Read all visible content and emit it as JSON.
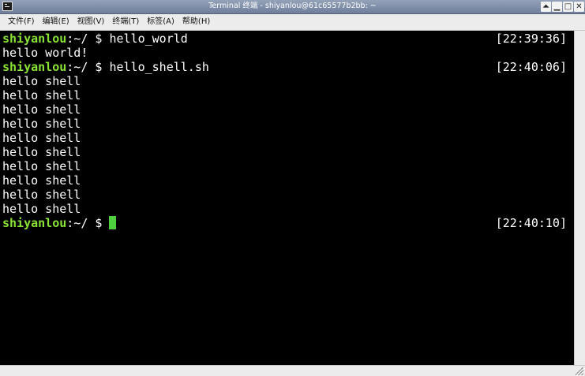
{
  "window": {
    "title": "Terminal 终端 - shiyanlou@61c65577b2bb: ~",
    "controls": {
      "shade": "⏶",
      "minimize": "▁",
      "maximize": "□",
      "close": "✕"
    }
  },
  "menubar": {
    "items": [
      {
        "label": "文件(F)"
      },
      {
        "label": "编辑(E)"
      },
      {
        "label": "视图(V)"
      },
      {
        "label": "终端(T)"
      },
      {
        "label": "标签(A)"
      },
      {
        "label": "帮助(H)"
      }
    ]
  },
  "terminal": {
    "prompt_user": "shiyanlou",
    "prompt_sep": ":~/ $ ",
    "lines": [
      {
        "type": "prompt",
        "command": "hello_world",
        "timestamp": "[22:39:36]"
      },
      {
        "type": "output",
        "text": "hello world!"
      },
      {
        "type": "prompt",
        "command": "hello_shell.sh",
        "timestamp": "[22:40:06]"
      },
      {
        "type": "output",
        "text": "hello shell"
      },
      {
        "type": "output",
        "text": "hello shell"
      },
      {
        "type": "output",
        "text": "hello shell"
      },
      {
        "type": "output",
        "text": "hello shell"
      },
      {
        "type": "output",
        "text": "hello shell"
      },
      {
        "type": "output",
        "text": "hello shell"
      },
      {
        "type": "output",
        "text": "hello shell"
      },
      {
        "type": "output",
        "text": "hello shell"
      },
      {
        "type": "output",
        "text": "hello shell"
      },
      {
        "type": "output",
        "text": "hello shell"
      },
      {
        "type": "prompt",
        "command": "",
        "timestamp": "[22:40:10]",
        "cursor": true
      }
    ],
    "colors": {
      "background": "#000000",
      "foreground": "#ffffff",
      "prompt_user": "#8ae234",
      "cursor": "#4ed13c"
    }
  }
}
